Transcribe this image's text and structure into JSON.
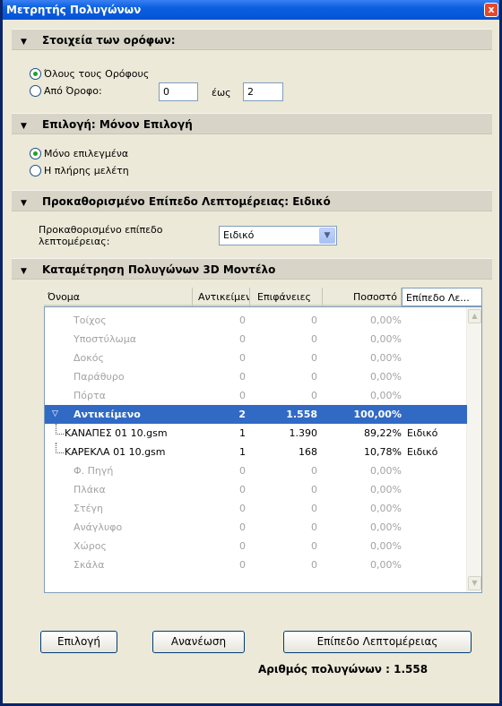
{
  "window": {
    "title": "Μετρητής Πολυγώνων",
    "close_glyph": "x"
  },
  "floors": {
    "header": "Στοιχεία των ορόφων:",
    "all_floors_label": "Όλους τους Ορόφους",
    "from_floor_label": "Από Όροφο:",
    "from_value": "0",
    "to_label": "έως",
    "to_value": "2",
    "selected": "all"
  },
  "selection": {
    "header": "Επιλογή: Μόνον Επιλογή",
    "only_selected_label": "Μόνο επιλεγμένα",
    "full_project_label": "Η πλήρης μελέτη",
    "selected": "only_selected"
  },
  "detail": {
    "header": "Προκαθορισμένο Επίπεδο Λεπτομέρειας: Ειδικό",
    "field_label_line1": "Προκαθορισμένο επίπεδο",
    "field_label_line2": "λεπτομέρειας:",
    "selected_value": "Ειδικό"
  },
  "count": {
    "header": "Καταμέτρηση Πολυγώνων 3D Μοντέλο",
    "columns": [
      "Όνομα",
      "Αντικείμενα",
      "Επιφάνειες",
      "Ποσοστό",
      "Επίπεδο Λε..."
    ],
    "rows": [
      {
        "name": "Τοίχος",
        "objects": "0",
        "surfaces": "0",
        "percent": "0,00%",
        "level": "",
        "style": "dim"
      },
      {
        "name": "Υποστύλωμα",
        "objects": "0",
        "surfaces": "0",
        "percent": "0,00%",
        "level": "",
        "style": "dim"
      },
      {
        "name": "Δοκός",
        "objects": "0",
        "surfaces": "0",
        "percent": "0,00%",
        "level": "",
        "style": "dim"
      },
      {
        "name": "Παράθυρο",
        "objects": "0",
        "surfaces": "0",
        "percent": "0,00%",
        "level": "",
        "style": "dim"
      },
      {
        "name": "Πόρτα",
        "objects": "0",
        "surfaces": "0",
        "percent": "0,00%",
        "level": "",
        "style": "dim"
      },
      {
        "name": "Αντικείμενο",
        "objects": "2",
        "surfaces": "1.558",
        "percent": "100,00%",
        "level": "",
        "style": "sel"
      },
      {
        "name": "ΚΑΝΑΠΕΣ 01 10.gsm",
        "objects": "1",
        "surfaces": "1.390",
        "percent": "89,22%",
        "level": "Ειδικό",
        "style": "child"
      },
      {
        "name": "ΚΑΡΕΚΛΑ 01 10.gsm",
        "objects": "1",
        "surfaces": "168",
        "percent": "10,78%",
        "level": "Ειδικό",
        "style": "child"
      },
      {
        "name": "Φ. Πηγή",
        "objects": "0",
        "surfaces": "0",
        "percent": "0,00%",
        "level": "",
        "style": "dim"
      },
      {
        "name": "Πλάκα",
        "objects": "0",
        "surfaces": "0",
        "percent": "0,00%",
        "level": "",
        "style": "dim"
      },
      {
        "name": "Στέγη",
        "objects": "0",
        "surfaces": "0",
        "percent": "0,00%",
        "level": "",
        "style": "dim"
      },
      {
        "name": "Ανάγλυφο",
        "objects": "0",
        "surfaces": "0",
        "percent": "0,00%",
        "level": "",
        "style": "dim"
      },
      {
        "name": "Χώρος",
        "objects": "0",
        "surfaces": "0",
        "percent": "0,00%",
        "level": "",
        "style": "dim"
      },
      {
        "name": "Σκάλα",
        "objects": "0",
        "surfaces": "0",
        "percent": "0,00%",
        "level": "",
        "style": "dim"
      }
    ]
  },
  "buttons": {
    "select": "Επιλογή",
    "refresh": "Ανανέωση",
    "detail_level": "Επίπεδο Λεπτομέρειας"
  },
  "total": {
    "text": "Αριθμός πολυγώνων : 1.558"
  },
  "colors": {
    "titlebar": "#0553d6",
    "selection": "#316ac5",
    "panel": "#ece9d8"
  },
  "icons": {
    "section_toggle": "triangle-down-icon",
    "tree_expand": "triangle-down-icon",
    "scroll_up": "chevron-up-icon",
    "scroll_down": "chevron-down-icon",
    "dropdown": "chevron-down-icon"
  }
}
